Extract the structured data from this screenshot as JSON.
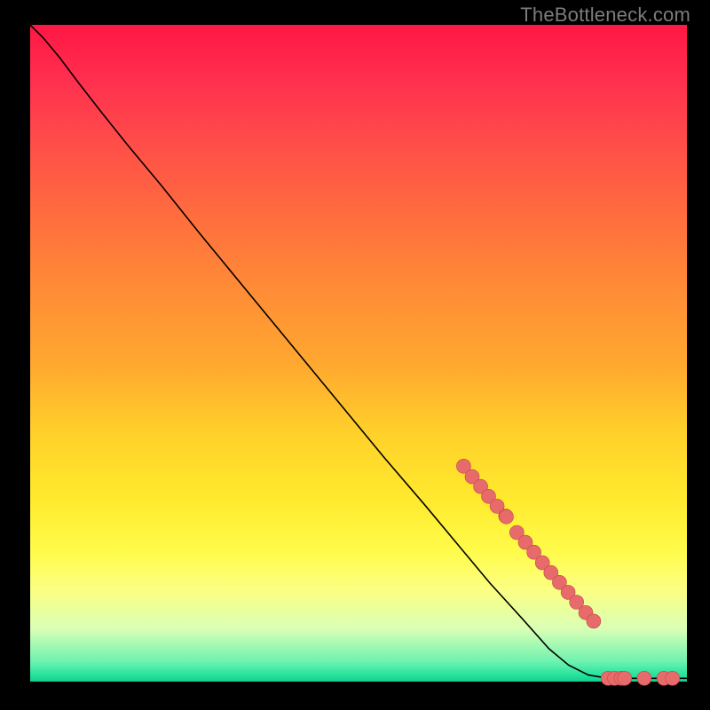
{
  "watermark": "TheBottleneck.com",
  "chart_data": {
    "type": "line",
    "title": "",
    "xlabel": "",
    "ylabel": "",
    "xlim": [
      0,
      1
    ],
    "ylim": [
      0,
      1
    ],
    "note": "Axes have no visible tick labels; values are normalized to 0–1 within the plot area, y increasing downward on screen as drawn.",
    "series": [
      {
        "name": "curve",
        "kind": "path",
        "points": [
          {
            "x": 0.0,
            "y": 0.0
          },
          {
            "x": 0.02,
            "y": 0.02
          },
          {
            "x": 0.045,
            "y": 0.05
          },
          {
            "x": 0.075,
            "y": 0.09
          },
          {
            "x": 0.11,
            "y": 0.135
          },
          {
            "x": 0.15,
            "y": 0.185
          },
          {
            "x": 0.2,
            "y": 0.245
          },
          {
            "x": 0.26,
            "y": 0.32
          },
          {
            "x": 0.33,
            "y": 0.405
          },
          {
            "x": 0.4,
            "y": 0.49
          },
          {
            "x": 0.47,
            "y": 0.575
          },
          {
            "x": 0.54,
            "y": 0.66
          },
          {
            "x": 0.6,
            "y": 0.73
          },
          {
            "x": 0.65,
            "y": 0.79
          },
          {
            "x": 0.7,
            "y": 0.85
          },
          {
            "x": 0.75,
            "y": 0.905
          },
          {
            "x": 0.79,
            "y": 0.95
          },
          {
            "x": 0.82,
            "y": 0.975
          },
          {
            "x": 0.85,
            "y": 0.99
          },
          {
            "x": 0.88,
            "y": 0.995
          },
          {
            "x": 0.92,
            "y": 0.995
          },
          {
            "x": 0.96,
            "y": 0.995
          },
          {
            "x": 1.0,
            "y": 0.995
          }
        ]
      },
      {
        "name": "markers",
        "kind": "scatter",
        "points": [
          {
            "x": 0.66,
            "y": 0.672
          },
          {
            "x": 0.673,
            "y": 0.688
          },
          {
            "x": 0.686,
            "y": 0.703
          },
          {
            "x": 0.698,
            "y": 0.718
          },
          {
            "x": 0.711,
            "y": 0.733
          },
          {
            "x": 0.724,
            "y": 0.748
          },
          {
            "x": 0.725,
            "y": 0.749
          },
          {
            "x": 0.741,
            "y": 0.773
          },
          {
            "x": 0.754,
            "y": 0.788
          },
          {
            "x": 0.767,
            "y": 0.803
          },
          {
            "x": 0.78,
            "y": 0.819
          },
          {
            "x": 0.793,
            "y": 0.834
          },
          {
            "x": 0.806,
            "y": 0.849
          },
          {
            "x": 0.819,
            "y": 0.864
          },
          {
            "x": 0.832,
            "y": 0.879
          },
          {
            "x": 0.846,
            "y": 0.895
          },
          {
            "x": 0.858,
            "y": 0.908
          },
          {
            "x": 0.88,
            "y": 0.995
          },
          {
            "x": 0.89,
            "y": 0.995
          },
          {
            "x": 0.9,
            "y": 0.995
          },
          {
            "x": 0.905,
            "y": 0.995
          },
          {
            "x": 0.935,
            "y": 0.995
          },
          {
            "x": 0.965,
            "y": 0.995
          },
          {
            "x": 0.978,
            "y": 0.995
          }
        ]
      }
    ]
  }
}
